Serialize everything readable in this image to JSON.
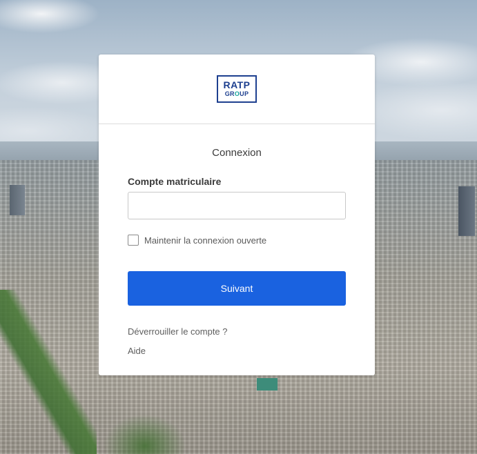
{
  "logo": {
    "top": "RATP",
    "bottom_before": "GR",
    "bottom_o": "O",
    "bottom_after": "UP"
  },
  "login": {
    "title": "Connexion",
    "username_label": "Compte matriculaire",
    "username_value": "",
    "remember_label": "Maintenir la connexion ouverte",
    "remember_checked": false,
    "submit_label": "Suivant",
    "unlock_link": "Déverrouiller le compte ?",
    "help_link": "Aide"
  },
  "colors": {
    "primary_button": "#1a62e0",
    "logo_blue": "#1d3f8f",
    "logo_teal": "#17a39b"
  }
}
